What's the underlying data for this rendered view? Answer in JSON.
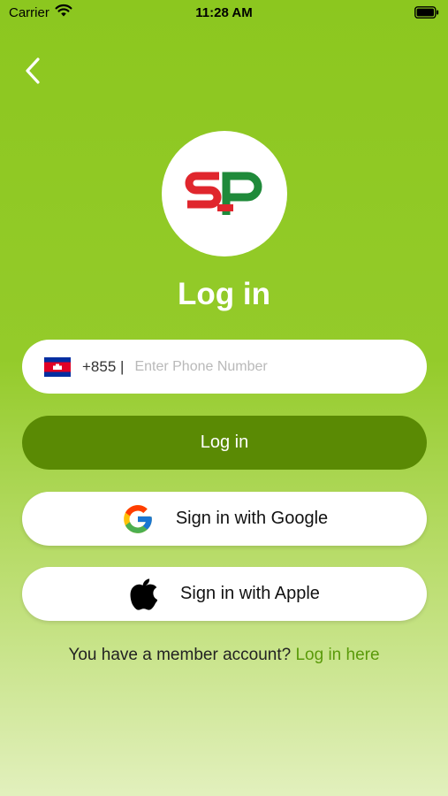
{
  "status_bar": {
    "carrier": "Carrier",
    "time": "11:28 AM"
  },
  "brand": {
    "logo_text": "SP",
    "colors": {
      "red": "#e0262d",
      "green": "#1f8a3a"
    }
  },
  "title": "Log in",
  "phone": {
    "country_code": "+855 |",
    "placeholder": "Enter Phone Number",
    "flag_icon": "cambodia-flag-icon"
  },
  "buttons": {
    "login": "Log in",
    "google": "Sign in with Google",
    "apple": "Sign in with Apple"
  },
  "footer": {
    "prompt": "You have a member account? ",
    "link": "Log in here"
  },
  "colors": {
    "background_top": "#8cc71f",
    "background_bottom": "#e2f0bd",
    "login_button": "#5a8a04",
    "link": "#5a9a0a"
  }
}
